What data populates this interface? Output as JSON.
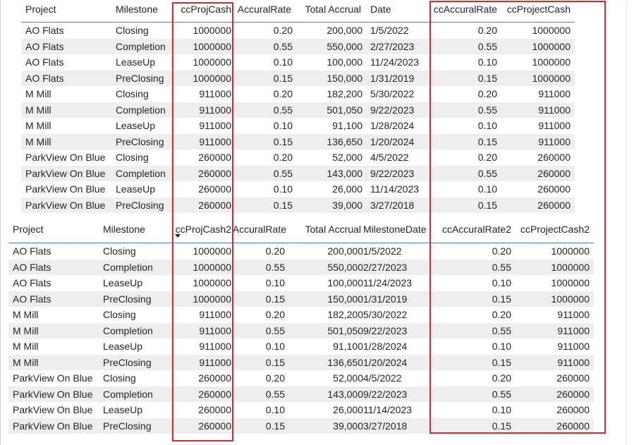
{
  "top_table": {
    "headers": [
      "Project",
      "Milestone",
      "ccProjCash",
      "AccuralRate",
      "Total Accrual",
      "Date",
      "ccAccuralRate",
      "ccProjectCash"
    ],
    "rows": [
      [
        "AO Flats",
        "Closing",
        "1000000",
        "0.20",
        "200,000",
        "1/5/2022",
        "0.20",
        "1000000"
      ],
      [
        "AO Flats",
        "Completion",
        "1000000",
        "0.55",
        "550,000",
        "2/27/2023",
        "0.55",
        "1000000"
      ],
      [
        "AO Flats",
        "LeaseUp",
        "1000000",
        "0.10",
        "100,000",
        "11/24/2023",
        "0.10",
        "1000000"
      ],
      [
        "AO Flats",
        "PreClosing",
        "1000000",
        "0.15",
        "150,000",
        "1/31/2019",
        "0.15",
        "1000000"
      ],
      [
        "M Mill",
        "Closing",
        "911000",
        "0.20",
        "182,200",
        "5/30/2022",
        "0.20",
        "911000"
      ],
      [
        "M Mill",
        "Completion",
        "911000",
        "0.55",
        "501,050",
        "9/22/2023",
        "0.55",
        "911000"
      ],
      [
        "M Mill",
        "LeaseUp",
        "911000",
        "0.10",
        "91,100",
        "1/28/2024",
        "0.10",
        "911000"
      ],
      [
        "M Mill",
        "PreClosing",
        "911000",
        "0.15",
        "136,650",
        "1/20/2024",
        "0.15",
        "911000"
      ],
      [
        "ParkView On Blue",
        "Closing",
        "260000",
        "0.20",
        "52,000",
        "4/5/2022",
        "0.20",
        "260000"
      ],
      [
        "ParkView On Blue",
        "Completion",
        "260000",
        "0.55",
        "143,000",
        "9/22/2023",
        "0.55",
        "260000"
      ],
      [
        "ParkView On Blue",
        "LeaseUp",
        "260000",
        "0.10",
        "26,000",
        "11/14/2023",
        "0.10",
        "260000"
      ],
      [
        "ParkView On Blue",
        "PreClosing",
        "260000",
        "0.15",
        "39,000",
        "3/27/2018",
        "0.15",
        "260000"
      ]
    ]
  },
  "bottom_table": {
    "headers": [
      "Project",
      "Milestone",
      "ccProjCash2",
      "AccuralRate",
      "Total Accrual",
      "MilestoneDate",
      "ccAccuralRate2",
      "ccProjectCash2"
    ],
    "sorted_column": "ccProjCash2",
    "rows": [
      [
        "AO Flats",
        "Closing",
        "1000000",
        "0.20",
        "200,000",
        "1/5/2022",
        "0.20",
        "1000000"
      ],
      [
        "AO Flats",
        "Completion",
        "1000000",
        "0.55",
        "550,000",
        "2/27/2023",
        "0.55",
        "1000000"
      ],
      [
        "AO Flats",
        "LeaseUp",
        "1000000",
        "0.10",
        "100,000",
        "11/24/2023",
        "0.10",
        "1000000"
      ],
      [
        "AO Flats",
        "PreClosing",
        "1000000",
        "0.15",
        "150,000",
        "1/31/2019",
        "0.15",
        "1000000"
      ],
      [
        "M Mill",
        "Closing",
        "911000",
        "0.20",
        "182,200",
        "5/30/2022",
        "0.20",
        "911000"
      ],
      [
        "M Mill",
        "Completion",
        "911000",
        "0.55",
        "501,050",
        "9/22/2023",
        "0.55",
        "911000"
      ],
      [
        "M Mill",
        "LeaseUp",
        "911000",
        "0.10",
        "91,100",
        "1/28/2024",
        "0.10",
        "911000"
      ],
      [
        "M Mill",
        "PreClosing",
        "911000",
        "0.15",
        "136,650",
        "1/20/2024",
        "0.15",
        "911000"
      ],
      [
        "ParkView On Blue",
        "Closing",
        "260000",
        "0.20",
        "52,000",
        "4/5/2022",
        "0.20",
        "260000"
      ],
      [
        "ParkView On Blue",
        "Completion",
        "260000",
        "0.55",
        "143,000",
        "9/22/2023",
        "0.55",
        "260000"
      ],
      [
        "ParkView On Blue",
        "LeaseUp",
        "260000",
        "0.10",
        "26,000",
        "11/14/2023",
        "0.10",
        "260000"
      ],
      [
        "ParkView On Blue",
        "PreClosing",
        "260000",
        "0.15",
        "39,000",
        "3/27/2018",
        "0.15",
        "260000"
      ]
    ]
  },
  "colors": {
    "highlight_box": "#e0262b",
    "header_rule": "#4a7bc9",
    "row_band": "#eeeeee"
  }
}
